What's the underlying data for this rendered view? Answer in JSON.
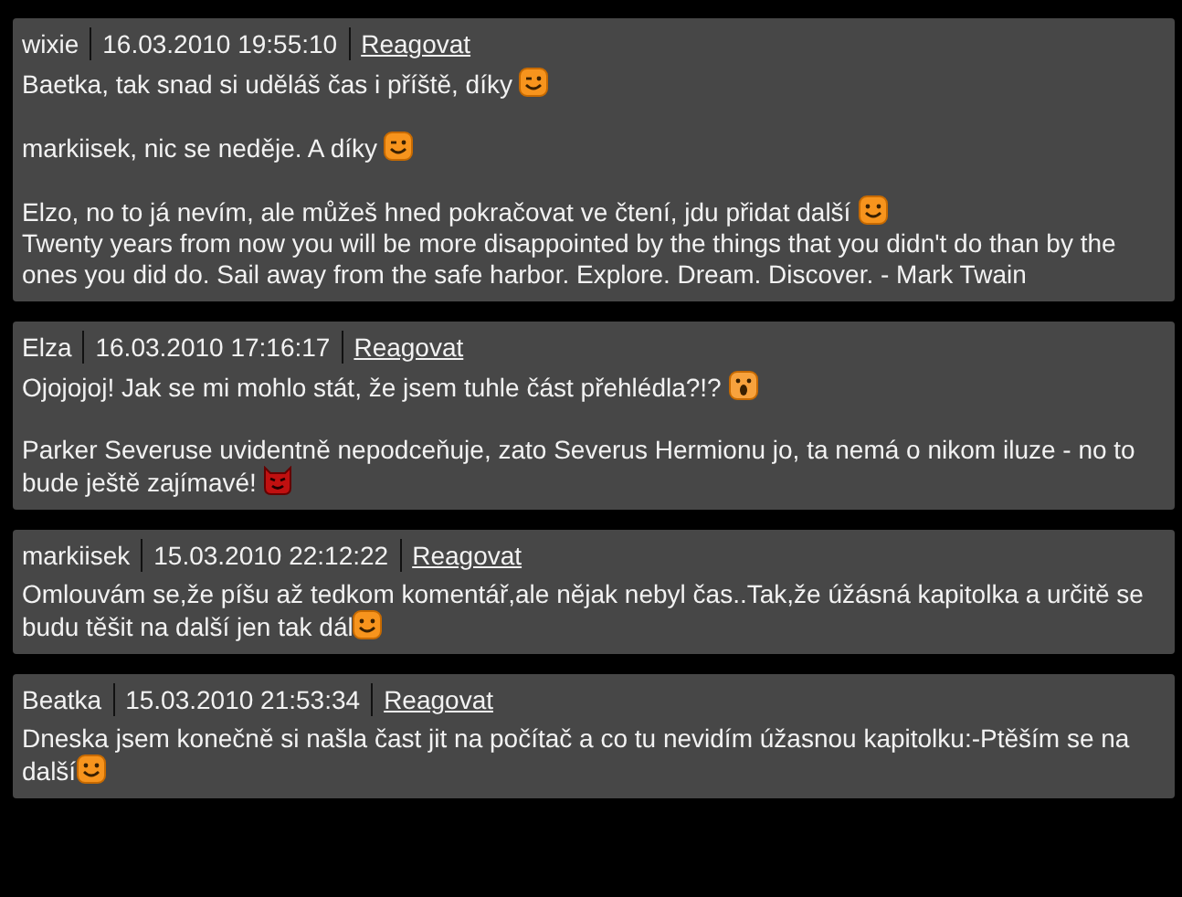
{
  "comments": [
    {
      "author": "wixie",
      "date": "16.03.2010 19:55:10",
      "reply": "Reagovat",
      "blocks": [
        [
          {
            "text": "Baetka, tak snad si uděláš čas i příště, díky ",
            "kind": "wink"
          }
        ],
        [
          {
            "text": "markiisek, nic se neděje. A díky ",
            "kind": "wink"
          }
        ],
        [
          {
            "text": "Elzo, no to já nevím, ale můžeš hned pokračovat ve čtení, jdu přidat další ",
            "kind": "smile"
          },
          {
            "text": "Twenty years from now you will be more disappointed by the things that you didn't do than by the ones you did do. Sail away from the safe harbor. Explore. Dream. Discover. - Mark Twain",
            "kind": "plain"
          }
        ]
      ]
    },
    {
      "author": "Elza",
      "date": "16.03.2010 17:16:17",
      "reply": "Reagovat",
      "blocks": [
        [
          {
            "text": "Ojojojoj! Jak se mi mohlo stát, že jsem tuhle část přehlédla?!? ",
            "kind": "surprised"
          }
        ],
        [
          {
            "text": "Parker Severuse uvidentně nepodceňuje, zato Severus Hermionu jo, ta nemá o nikom iluze - no to bude ještě zajímavé! ",
            "kind": "devil"
          }
        ]
      ]
    },
    {
      "author": "markiisek",
      "date": "15.03.2010 22:12:22",
      "reply": "Reagovat",
      "blocks": [
        [
          {
            "text": "Omlouvám se,že píšu až tedkom komentář,ale nějak nebyl čas..Tak,že úžásná kapitolka a určitě se budu těšit na další jen tak dál",
            "kind": "smile"
          }
        ]
      ]
    },
    {
      "author": "Beatka",
      "date": "15.03.2010 21:53:34",
      "reply": "Reagovat",
      "blocks": [
        [
          {
            "text": "Dneska jsem konečně si našla čast jit na počítač a co tu nevidím úžasnou kapitolku:-Ptěším se na další",
            "kind": "smile"
          }
        ]
      ]
    }
  ]
}
